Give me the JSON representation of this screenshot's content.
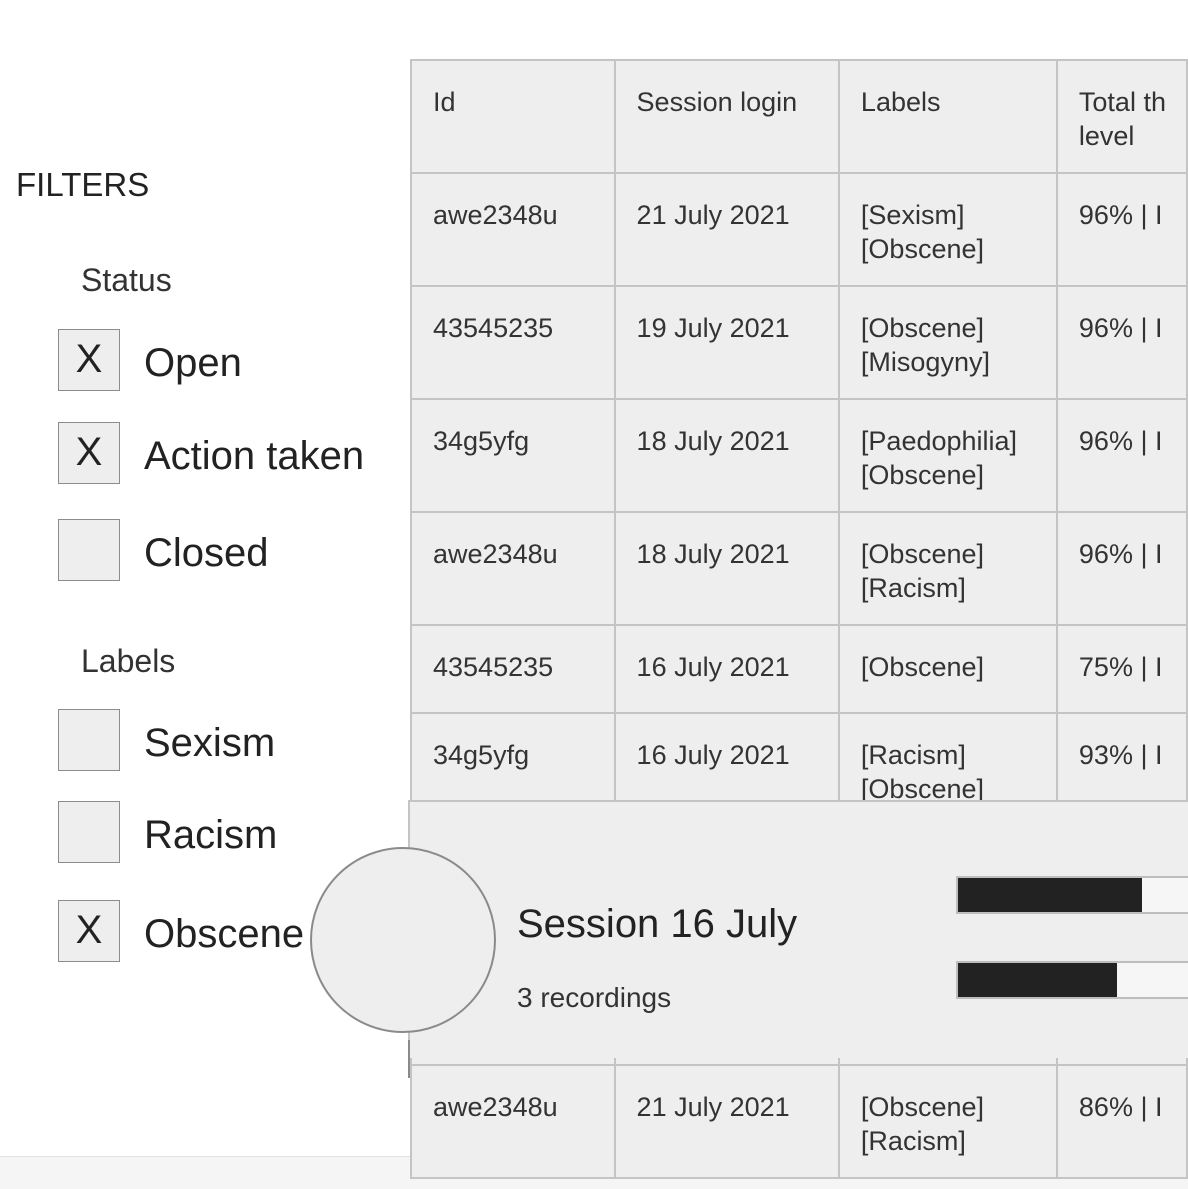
{
  "filters": {
    "title": "FILTERS",
    "status": {
      "title": "Status",
      "options": [
        {
          "label": "Open",
          "checked": true,
          "mark": "X"
        },
        {
          "label": "Action taken",
          "checked": true,
          "mark": "X"
        },
        {
          "label": "Closed",
          "checked": false,
          "mark": ""
        }
      ]
    },
    "labels": {
      "title": "Labels",
      "options": [
        {
          "label": "Sexism",
          "checked": false,
          "mark": ""
        },
        {
          "label": "Racism",
          "checked": false,
          "mark": ""
        },
        {
          "label": "Obscene",
          "checked": true,
          "mark": "X"
        }
      ]
    }
  },
  "table": {
    "headers": {
      "id": "Id",
      "session_login": "Session login",
      "labels": "Labels",
      "total_line1": "Total th",
      "total_line2": "level"
    },
    "rows": [
      {
        "id": "awe2348u",
        "date": "21 July  2021",
        "label1": "[Sexism]",
        "label2": "[Obscene]",
        "total": "96% | I"
      },
      {
        "id": "43545235",
        "date": "19 July  2021",
        "label1": "[Obscene]",
        "label2": "[Misogyny]",
        "total": "96% | I"
      },
      {
        "id": "34g5yfg",
        "date": "18 July  2021",
        "label1": "[Paedophilia]",
        "label2": "[Obscene]",
        "total": "96% | I"
      },
      {
        "id": "awe2348u",
        "date": "18 July  2021",
        "label1": "[Obscene]",
        "label2": "[Racism]",
        "total": "96% | I"
      },
      {
        "id": "43545235",
        "date": "16 July  2021",
        "label1": "[Obscene]",
        "label2": "",
        "total": "75% | I"
      },
      {
        "id": "34g5yfg",
        "date": "16 July  2021",
        "label1": "[Racism]",
        "label2": "[Obscene]",
        "total": "93% | I"
      },
      {
        "id": "awe2348u",
        "date": "21 July  2021",
        "label1": "[Obscene]",
        "label2": "[Racism]",
        "total": "86% | I"
      }
    ]
  },
  "session_card": {
    "title": "Session 16 July",
    "subtitle": "3 recordings",
    "bars": [
      {
        "fraction": 0.72
      },
      {
        "fraction": 0.62
      }
    ]
  }
}
